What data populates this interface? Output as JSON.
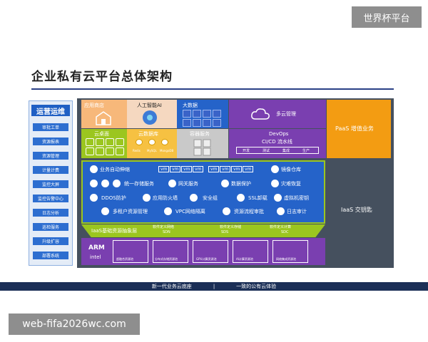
{
  "watermark_top": "世界杯平台",
  "watermark_bottom": "web-fifa2026wc.com",
  "title": "企业私有云平台总体架构",
  "sidebar": {
    "title": "运营运维",
    "items": [
      "审批工单",
      "资源报表",
      "资源管理",
      "计量计费",
      "监控大屏",
      "监控告警中心",
      "日志分析",
      "巡检服务",
      "升级扩容",
      "部署系统"
    ]
  },
  "top_row": {
    "app_store": "应用商店",
    "ai": "人工智能AI",
    "bigdata": "大数据",
    "multicloud": "多云管理",
    "paas": "PaaS 增值业务"
  },
  "second_row": {
    "cloud_desktop": "云桌面",
    "cloud_storage": "云数据库",
    "container": "容器服务",
    "devops": "DevOps",
    "cicd": "CI/CD 流水线",
    "pipeline": [
      "开发",
      "测试",
      "集成",
      "生产"
    ],
    "storage_tags": [
      "Redis",
      "MySQL",
      "MongoDB"
    ]
  },
  "iaas_panel": {
    "auto_scale": "业务自动伸缩",
    "vm_tag": "vm",
    "image_repo": "镜像仓库",
    "unified_storage": "统一存储服务",
    "network_service": "网关服务",
    "data_protection": "数据保护",
    "disaster_recovery": "灾难恢复",
    "ddos": "DDOS防护",
    "waf": "应用防火墙",
    "security_group": "安全组",
    "ssl": "SSL卸载",
    "vm_key": "虚拟机密钥",
    "multi_tenant": "多租户资源管理",
    "vpc": "VPC网络隔离",
    "resource_flow": "资源流程审批",
    "log_audit": "日志审计",
    "iaas_base": "IaaS基础资源抽象层",
    "sdn": "软件定义网络",
    "sdn_short": "SDN",
    "sds": "软件定义存储",
    "sds_short": "SDS",
    "sdc": "软件定义计算",
    "sdc_short": "SDC"
  },
  "iaas_side": "IaaS 交钥匙",
  "hardware": {
    "arm": "ARM",
    "intel": "intel",
    "items": [
      "超融合资源池",
      "分布式存储资源池",
      "GPU计算资源池",
      "AI计算资源池",
      "网络集成资源池"
    ]
  },
  "bottom_band": [
    "新一代业务云底座",
    "|",
    "一致的公有云体验"
  ],
  "colors": {
    "orange": "#f39c12",
    "blue": "#2563c9",
    "green_border": "#9bc61f",
    "purple": "#7a3fb0",
    "dark_band": "#1b2f57"
  }
}
